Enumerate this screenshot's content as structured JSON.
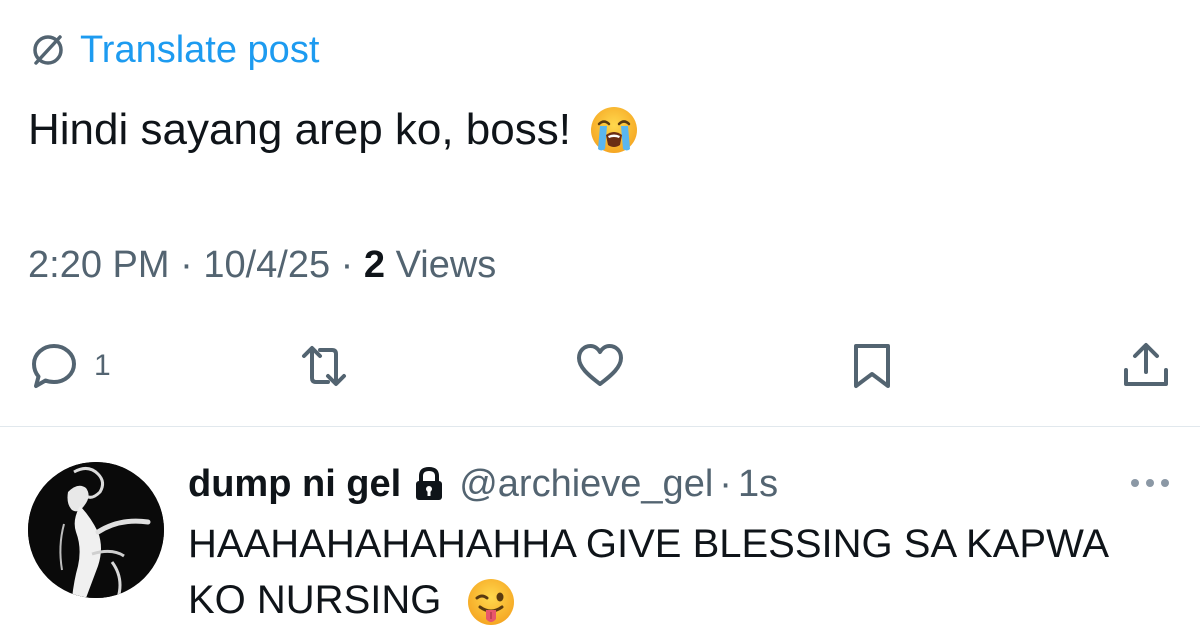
{
  "post": {
    "translate_label": "Translate post",
    "text": "Hindi sayang arep ko, boss!",
    "text_emoji": "loudly-crying-face",
    "time": "2:20 PM",
    "date": "10/4/25",
    "views_count": "2",
    "views_label": "Views",
    "actions": {
      "reply_count": "1"
    }
  },
  "reply": {
    "display_name": "dump ni gel",
    "handle": "@archieve_gel",
    "separator": "·",
    "time_ago": "1s",
    "text": "HAAHAHAHAHAHHA GIVE BLESSING SA KAPWA KO NURSING",
    "text_emoji": "winking-face-with-tongue"
  },
  "colors": {
    "accent": "#1d9bf0",
    "secondary_text": "#536471",
    "primary_text": "#0f1419",
    "divider": "#e1e8ed"
  },
  "icons": [
    "translate-icon",
    "reply-icon",
    "repost-icon",
    "like-icon",
    "bookmark-icon",
    "share-icon",
    "lock-icon",
    "more-icon"
  ]
}
